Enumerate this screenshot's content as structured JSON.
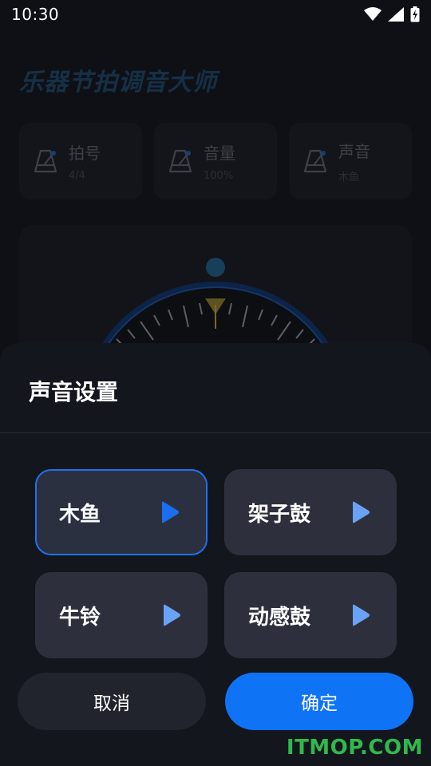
{
  "status_bar": {
    "time": "10:30",
    "icons": [
      "wifi-icon",
      "signal-icon",
      "battery-charging-icon"
    ]
  },
  "app": {
    "title": "乐器节拍调音大师"
  },
  "cards": [
    {
      "label": "拍号",
      "value": "4/4",
      "icon": "metronome-icon"
    },
    {
      "label": "音量",
      "value": "100%",
      "icon": "metronome-icon"
    },
    {
      "label": "声音",
      "value": "木鱼",
      "icon": "metronome-icon"
    }
  ],
  "dialog": {
    "title": "声音设置",
    "options": [
      {
        "label": "木鱼",
        "selected": true
      },
      {
        "label": "架子鼓",
        "selected": false
      },
      {
        "label": "牛铃",
        "selected": false
      },
      {
        "label": "动感鼓",
        "selected": false
      }
    ],
    "cancel_label": "取消",
    "confirm_label": "确定"
  },
  "colors": {
    "accent": "#0f73f5",
    "selected_border": "#1b73f0",
    "play_selected": "#1a6ff0",
    "play_default": "#6aa2f7",
    "watermark": "#2fb84d"
  },
  "watermark": "ITMOP.COM"
}
